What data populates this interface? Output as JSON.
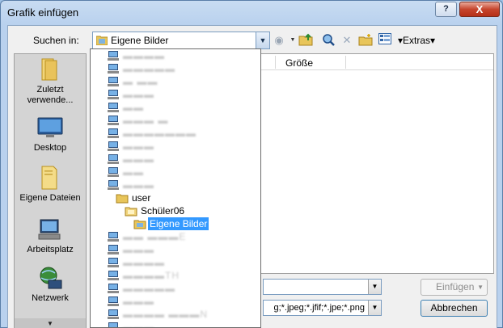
{
  "window": {
    "title": "Grafik einfügen",
    "help_label": "?",
    "close_label": "X"
  },
  "toolbar": {
    "lookin_label": "Suchen in:",
    "lookin_value": "Eigene Bilder",
    "extras_label": "▾Extras▾"
  },
  "places": [
    {
      "label": "Zuletzt verwende...",
      "icon": "recent-folder-icon"
    },
    {
      "label": "Desktop",
      "icon": "desktop-icon"
    },
    {
      "label": "Eigene Dateien",
      "icon": "folder-icon"
    },
    {
      "label": "Arbeitsplatz",
      "icon": "computer-icon"
    },
    {
      "label": "Netzwerk",
      "icon": "network-icon"
    }
  ],
  "filelist": {
    "columns": [
      "Größe"
    ]
  },
  "dropdown": {
    "items": [
      {
        "label": "▬▬▬▬",
        "indent": 0,
        "icon": "computer-icon",
        "obscured": true
      },
      {
        "label": "▬▬▬▬▬",
        "indent": 0,
        "icon": "computer-icon",
        "obscured": true
      },
      {
        "label": "▬ ▬▬",
        "indent": 0,
        "icon": "computer-icon",
        "obscured": true
      },
      {
        "label": "▬▬▬",
        "indent": 0,
        "icon": "computer-icon",
        "obscured": true
      },
      {
        "label": "▬▬",
        "indent": 0,
        "icon": "computer-icon",
        "obscured": true
      },
      {
        "label": "▬▬▬ ▬",
        "indent": 0,
        "icon": "computer-icon",
        "obscured": true
      },
      {
        "label": "▬▬▬▬▬▬▬",
        "indent": 0,
        "icon": "computer-icon",
        "obscured": true
      },
      {
        "label": "▬▬▬",
        "indent": 0,
        "icon": "computer-icon",
        "obscured": true
      },
      {
        "label": "▬▬▬",
        "indent": 0,
        "icon": "computer-icon",
        "obscured": true
      },
      {
        "label": "▬▬",
        "indent": 0,
        "icon": "computer-icon",
        "obscured": true
      },
      {
        "label": "▬▬▬",
        "indent": 0,
        "icon": "computer-icon",
        "obscured": true
      },
      {
        "label": "user",
        "indent": 1,
        "icon": "user-folder-icon",
        "obscured": false
      },
      {
        "label": "Schüler06",
        "indent": 2,
        "icon": "folder-icon",
        "obscured": false
      },
      {
        "label": "Eigene Bilder",
        "indent": 3,
        "icon": "pictures-folder-icon",
        "obscured": false,
        "selected": true
      },
      {
        "label": "▬▬ ▬▬▬E",
        "indent": 0,
        "icon": "computer-icon",
        "obscured": true
      },
      {
        "label": "▬▬▬",
        "indent": 0,
        "icon": "computer-icon",
        "obscured": true
      },
      {
        "label": "▬▬▬▬",
        "indent": 0,
        "icon": "computer-icon",
        "obscured": true
      },
      {
        "label": "▬▬▬▬TH",
        "indent": 0,
        "icon": "computer-icon",
        "obscured": true
      },
      {
        "label": "▬▬▬▬▬",
        "indent": 0,
        "icon": "computer-icon",
        "obscured": true
      },
      {
        "label": "▬▬▬",
        "indent": 0,
        "icon": "computer-icon",
        "obscured": true
      },
      {
        "label": "▬▬▬▬ ▬▬▬N",
        "indent": 0,
        "icon": "computer-icon",
        "obscured": true
      },
      {
        "label": "▬▬▬",
        "indent": 0,
        "icon": "computer-icon",
        "obscured": true
      }
    ]
  },
  "fields": {
    "filetype_value": "g;*.jpeg;*.jfif;*.jpe;*.png"
  },
  "buttons": {
    "insert_label": "Einfügen",
    "cancel_label": "Abbrechen"
  }
}
